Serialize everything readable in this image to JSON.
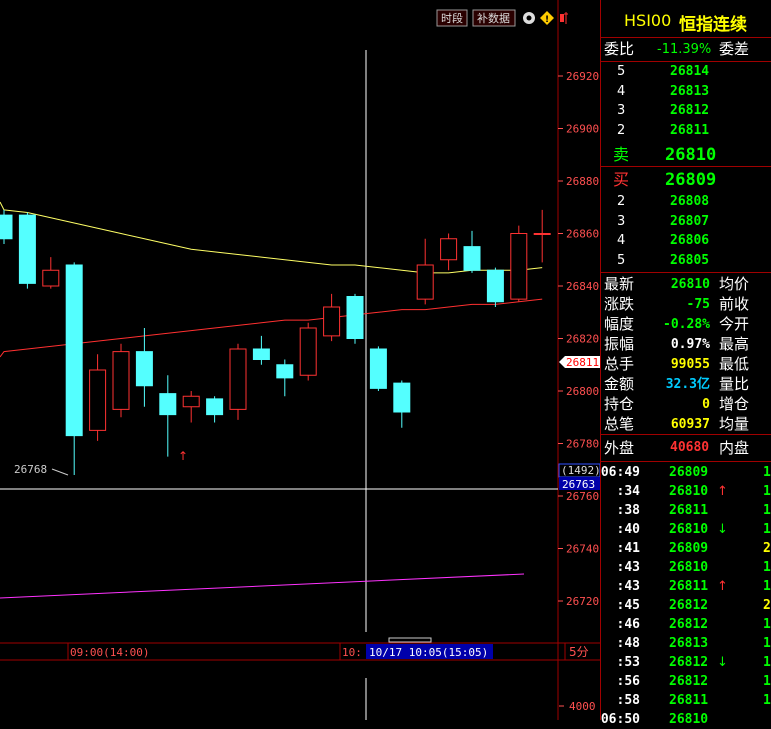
{
  "toolbar": {
    "btn_period": "时段",
    "btn_supplement": "补数据"
  },
  "title": {
    "code": "HSI00",
    "name": "恒指连续"
  },
  "weibi": {
    "label": "委比",
    "value": "-11.39%",
    "diff_label": "委差"
  },
  "asks": [
    {
      "level": "5",
      "price": "26814"
    },
    {
      "level": "4",
      "price": "26813"
    },
    {
      "level": "3",
      "price": "26812"
    },
    {
      "level": "2",
      "price": "26811"
    }
  ],
  "ask1": {
    "label": "卖",
    "price": "26810"
  },
  "bid1": {
    "label": "买",
    "price": "26809"
  },
  "bids": [
    {
      "level": "2",
      "price": "26808"
    },
    {
      "level": "3",
      "price": "26807"
    },
    {
      "level": "4",
      "price": "26806"
    },
    {
      "level": "5",
      "price": "26805"
    }
  ],
  "stats": [
    {
      "label": "最新",
      "value": "26810",
      "label2": "均价",
      "color": "#00ff00"
    },
    {
      "label": "涨跌",
      "value": "-75",
      "label2": "前收",
      "color": "#00ff00"
    },
    {
      "label": "幅度",
      "value": "-0.28%",
      "label2": "今开",
      "color": "#00ff00"
    },
    {
      "label": "振幅",
      "value": "0.97%",
      "label2": "最高",
      "color": "#ffffff"
    },
    {
      "label": "总手",
      "value": "99055",
      "label2": "最低",
      "color": "#ffff00"
    },
    {
      "label": "金额",
      "value": "32.3亿",
      "label2": "量比",
      "color": "#00ccff"
    },
    {
      "label": "持仓",
      "value": "0",
      "label2": "增仓",
      "color": "#ffff00"
    },
    {
      "label": "总笔",
      "value": "60937",
      "label2": "均量",
      "color": "#ffff00"
    }
  ],
  "outer_inner": {
    "outer_label": "外盘",
    "outer_value": "40680",
    "inner_label": "内盘"
  },
  "ticks": [
    {
      "time": "06:49",
      "price": "26809",
      "arrow": "",
      "vol": "1"
    },
    {
      "time": ":34",
      "price": "26810",
      "arrow": "↑",
      "vol": "1"
    },
    {
      "time": ":38",
      "price": "26811",
      "arrow": "",
      "vol": "1"
    },
    {
      "time": ":40",
      "price": "26810",
      "arrow": "↓",
      "vol": "1"
    },
    {
      "time": ":41",
      "price": "26809",
      "arrow": "",
      "vol": "2"
    },
    {
      "time": ":43",
      "price": "26810",
      "arrow": "",
      "vol": "1"
    },
    {
      "time": ":43",
      "price": "26811",
      "arrow": "↑",
      "vol": "1"
    },
    {
      "time": ":45",
      "price": "26812",
      "arrow": "",
      "vol": "2"
    },
    {
      "time": ":46",
      "price": "26812",
      "arrow": "",
      "vol": "1"
    },
    {
      "time": ":48",
      "price": "26813",
      "arrow": "",
      "vol": "1"
    },
    {
      "time": ":53",
      "price": "26812",
      "arrow": "↓",
      "vol": "1"
    },
    {
      "time": ":56",
      "price": "26812",
      "arrow": "",
      "vol": "1"
    },
    {
      "time": ":58",
      "price": "26811",
      "arrow": "",
      "vol": "1"
    },
    {
      "time": "06:50",
      "price": "26810",
      "arrow": "",
      "vol": ""
    }
  ],
  "time_axis": {
    "label1": "09:00(14:00)",
    "label2": "10:",
    "cursor_label": "10/17 10:05(15:05)",
    "period": "5分"
  },
  "axis_labels": {
    "low_marker": "26768",
    "current_price": "26811",
    "count_badge": "(1492)",
    "cursor_price": "26763",
    "volume_label": "4000"
  },
  "colors": {
    "up": "#ff3232",
    "down": "#54ffff",
    "ma_yellow": "#ffff66",
    "ma_red": "#ff3030",
    "ma_magenta": "#ff33ff",
    "bg": "#000000",
    "grid": "#a00000"
  },
  "chart_data": {
    "type": "candlestick",
    "ylim": [
      26760,
      26930
    ],
    "yticks": [
      26920,
      26900,
      26880,
      26860,
      26840,
      26820,
      26800,
      26780,
      26760,
      26740,
      26720
    ],
    "candles": [
      {
        "o": 26867,
        "c": 26858,
        "h": 26869,
        "l": 26856
      },
      {
        "o": 26867,
        "c": 26841,
        "h": 26868,
        "l": 26839
      },
      {
        "o": 26840,
        "c": 26846,
        "h": 26851,
        "l": 26839
      },
      {
        "o": 26848,
        "c": 26783,
        "h": 26849,
        "l": 26768
      },
      {
        "o": 26785,
        "c": 26808,
        "h": 26814,
        "l": 26781
      },
      {
        "o": 26793,
        "c": 26815,
        "h": 26818,
        "l": 26790
      },
      {
        "o": 26815,
        "c": 26802,
        "h": 26824,
        "l": 26794
      },
      {
        "o": 26799,
        "c": 26791,
        "h": 26806,
        "l": 26775
      },
      {
        "o": 26794,
        "c": 26798,
        "h": 26800,
        "l": 26788
      },
      {
        "o": 26797,
        "c": 26791,
        "h": 26798,
        "l": 26788
      },
      {
        "o": 26793,
        "c": 26816,
        "h": 26818,
        "l": 26789
      },
      {
        "o": 26816,
        "c": 26812,
        "h": 26821,
        "l": 26810
      },
      {
        "o": 26810,
        "c": 26805,
        "h": 26812,
        "l": 26798
      },
      {
        "o": 26806,
        "c": 26824,
        "h": 26826,
        "l": 26804
      },
      {
        "o": 26821,
        "c": 26832,
        "h": 26837,
        "l": 26819
      },
      {
        "o": 26836,
        "c": 26820,
        "h": 26837,
        "l": 26818
      },
      {
        "o": 26816,
        "c": 26801,
        "h": 26817,
        "l": 26800
      },
      {
        "o": 26803,
        "c": 26792,
        "h": 26804,
        "l": 26786
      },
      {
        "o": 26835,
        "c": 26848,
        "h": 26858,
        "l": 26833
      },
      {
        "o": 26850,
        "c": 26858,
        "h": 26860,
        "l": 26846
      },
      {
        "o": 26855,
        "c": 26846,
        "h": 26861,
        "l": 26845
      },
      {
        "o": 26846,
        "c": 26834,
        "h": 26847,
        "l": 26832
      },
      {
        "o": 26835,
        "c": 26860,
        "h": 26863,
        "l": 26834
      },
      {
        "o": 26860,
        "c": 26860,
        "h": 26869,
        "l": 26849
      }
    ],
    "ma_yellow": [
      26869,
      26868,
      26866,
      26864,
      26862,
      26860,
      26858,
      26856,
      26854,
      26853,
      26852,
      26851,
      26850,
      26849,
      26848,
      26848,
      26847,
      26846,
      26845,
      26845,
      26846,
      26846,
      26846,
      26847
    ],
    "ma_red": [
      26815,
      26816,
      26817,
      26818,
      26819,
      26820,
      26821,
      26822,
      26823,
      26824,
      26825,
      26826,
      26827,
      26827,
      26828,
      26829,
      26830,
      26831,
      26831,
      26832,
      26833,
      26833,
      26834,
      26835
    ]
  }
}
